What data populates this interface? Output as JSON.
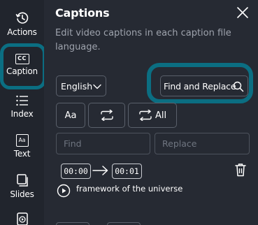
{
  "sidebar": {
    "items": [
      {
        "label": "Actions",
        "icon": "history-icon"
      },
      {
        "label": "Caption",
        "icon": "closed-captions-icon",
        "icon_text": "CC"
      },
      {
        "label": "Index",
        "icon": "list-icon"
      },
      {
        "label": "Text",
        "icon": "text-box-icon",
        "icon_text": "Aa"
      },
      {
        "label": "Slides",
        "icon": "slides-icon"
      }
    ]
  },
  "panel": {
    "title": "Captions",
    "description": "Edit video captions in each caption file language."
  },
  "language": {
    "selected": "English"
  },
  "find_replace_button": {
    "label": "Find and Replace"
  },
  "tools": {
    "case_label": "Aa",
    "replace_all_label": "All"
  },
  "fields": {
    "find_placeholder": "Find",
    "replace_placeholder": "Replace"
  },
  "caption_entry": {
    "start": "00:00",
    "end": "00:01",
    "text": "framework of the universe"
  },
  "colors": {
    "background": "#262a33",
    "rail": "#21252d",
    "highlight_ring": "#0b6e82",
    "muted_text": "#9ea3ad"
  }
}
